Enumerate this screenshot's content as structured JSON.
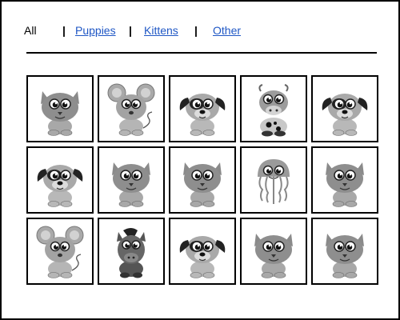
{
  "filter_nav": {
    "items": [
      {
        "label": "All",
        "type": "current"
      },
      {
        "label": "|",
        "type": "separator"
      },
      {
        "label": "Puppies",
        "type": "link"
      },
      {
        "label": "|",
        "type": "separator"
      },
      {
        "label": "Kittens",
        "type": "link"
      },
      {
        "label": "|",
        "type": "separator"
      },
      {
        "label": "Other",
        "type": "link"
      }
    ]
  },
  "gallery": {
    "rows": [
      [
        "cat",
        "mouse",
        "dog",
        "cow",
        "dog"
      ],
      [
        "dog",
        "cat",
        "cat",
        "jellyfish",
        "cat"
      ],
      [
        "mouse",
        "horse",
        "dog",
        "cat",
        "cat"
      ]
    ]
  }
}
